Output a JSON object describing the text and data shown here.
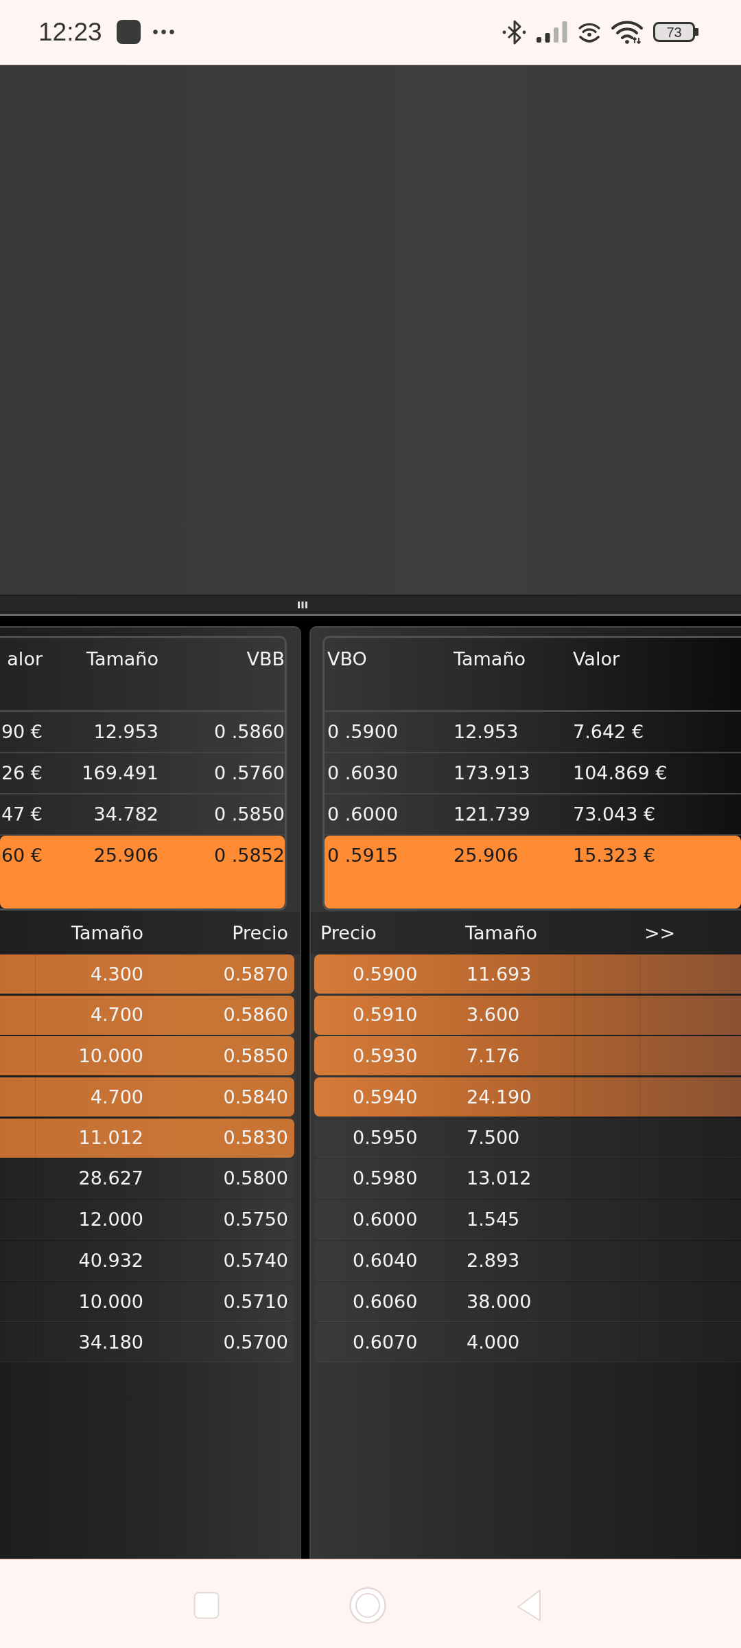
{
  "status_bar": {
    "time": "12:23",
    "battery": "73"
  },
  "bid_summary": {
    "columns": [
      "alor",
      "Tamaño",
      "VBB"
    ],
    "rows": [
      {
        "cells": [
          "90 €",
          "12.953",
          "0 .5860"
        ],
        "highlighted": false
      },
      {
        "cells": [
          "26 €",
          "169.491",
          "0 .5760"
        ],
        "highlighted": false
      },
      {
        "cells": [
          "47 €",
          "34.782",
          "0 .5850"
        ],
        "highlighted": false
      },
      {
        "cells": [
          "60 €",
          "25.906",
          "0 .5852"
        ],
        "highlighted": true
      }
    ]
  },
  "ask_summary": {
    "columns": [
      "VBO",
      "Tamaño",
      "Valor"
    ],
    "rows": [
      {
        "cells": [
          "0 .5900",
          "12.953",
          "7.642 €"
        ],
        "highlighted": false
      },
      {
        "cells": [
          "0 .6030",
          "173.913",
          "104.869 €"
        ],
        "highlighted": false
      },
      {
        "cells": [
          "0 .6000",
          "121.739",
          "73.043 €"
        ],
        "highlighted": false
      },
      {
        "cells": [
          "0 .5915",
          "25.906",
          "15.323 €"
        ],
        "highlighted": true
      }
    ]
  },
  "bids": {
    "columns": [
      "Tamaño",
      "Precio"
    ],
    "rows": [
      {
        "cells": [
          "4.300",
          "0.5870"
        ],
        "highlighted": true
      },
      {
        "cells": [
          "4.700",
          "0.5860"
        ],
        "highlighted": true
      },
      {
        "cells": [
          "10.000",
          "0.5850"
        ],
        "highlighted": true
      },
      {
        "cells": [
          "4.700",
          "0.5840"
        ],
        "highlighted": true
      },
      {
        "cells": [
          "11.012",
          "0.5830"
        ],
        "highlighted": true
      },
      {
        "cells": [
          "28.627",
          "0.5800"
        ],
        "highlighted": false
      },
      {
        "cells": [
          "12.000",
          "0.5750"
        ],
        "highlighted": false
      },
      {
        "cells": [
          "40.932",
          "0.5740"
        ],
        "highlighted": false
      },
      {
        "cells": [
          "10.000",
          "0.5710"
        ],
        "highlighted": false
      },
      {
        "cells": [
          "34.180",
          "0.5700"
        ],
        "highlighted": false
      }
    ]
  },
  "asks": {
    "columns": [
      "Precio",
      "Tamaño",
      ">>"
    ],
    "rows": [
      {
        "cells": [
          "0.5900",
          "11.693"
        ],
        "highlighted": true
      },
      {
        "cells": [
          "0.5910",
          "3.600"
        ],
        "highlighted": true
      },
      {
        "cells": [
          "0.5930",
          "7.176"
        ],
        "highlighted": true
      },
      {
        "cells": [
          "0.5940",
          "24.190"
        ],
        "highlighted": true
      },
      {
        "cells": [
          "0.5950",
          "7.500"
        ],
        "highlighted": false
      },
      {
        "cells": [
          "0.5980",
          "13.012"
        ],
        "highlighted": false
      },
      {
        "cells": [
          "0.6000",
          "1.545"
        ],
        "highlighted": false
      },
      {
        "cells": [
          "0.6040",
          "2.893"
        ],
        "highlighted": false
      },
      {
        "cells": [
          "0.6060",
          "38.000"
        ],
        "highlighted": false
      },
      {
        "cells": [
          "0.6070",
          "4.000"
        ],
        "highlighted": false
      }
    ]
  }
}
